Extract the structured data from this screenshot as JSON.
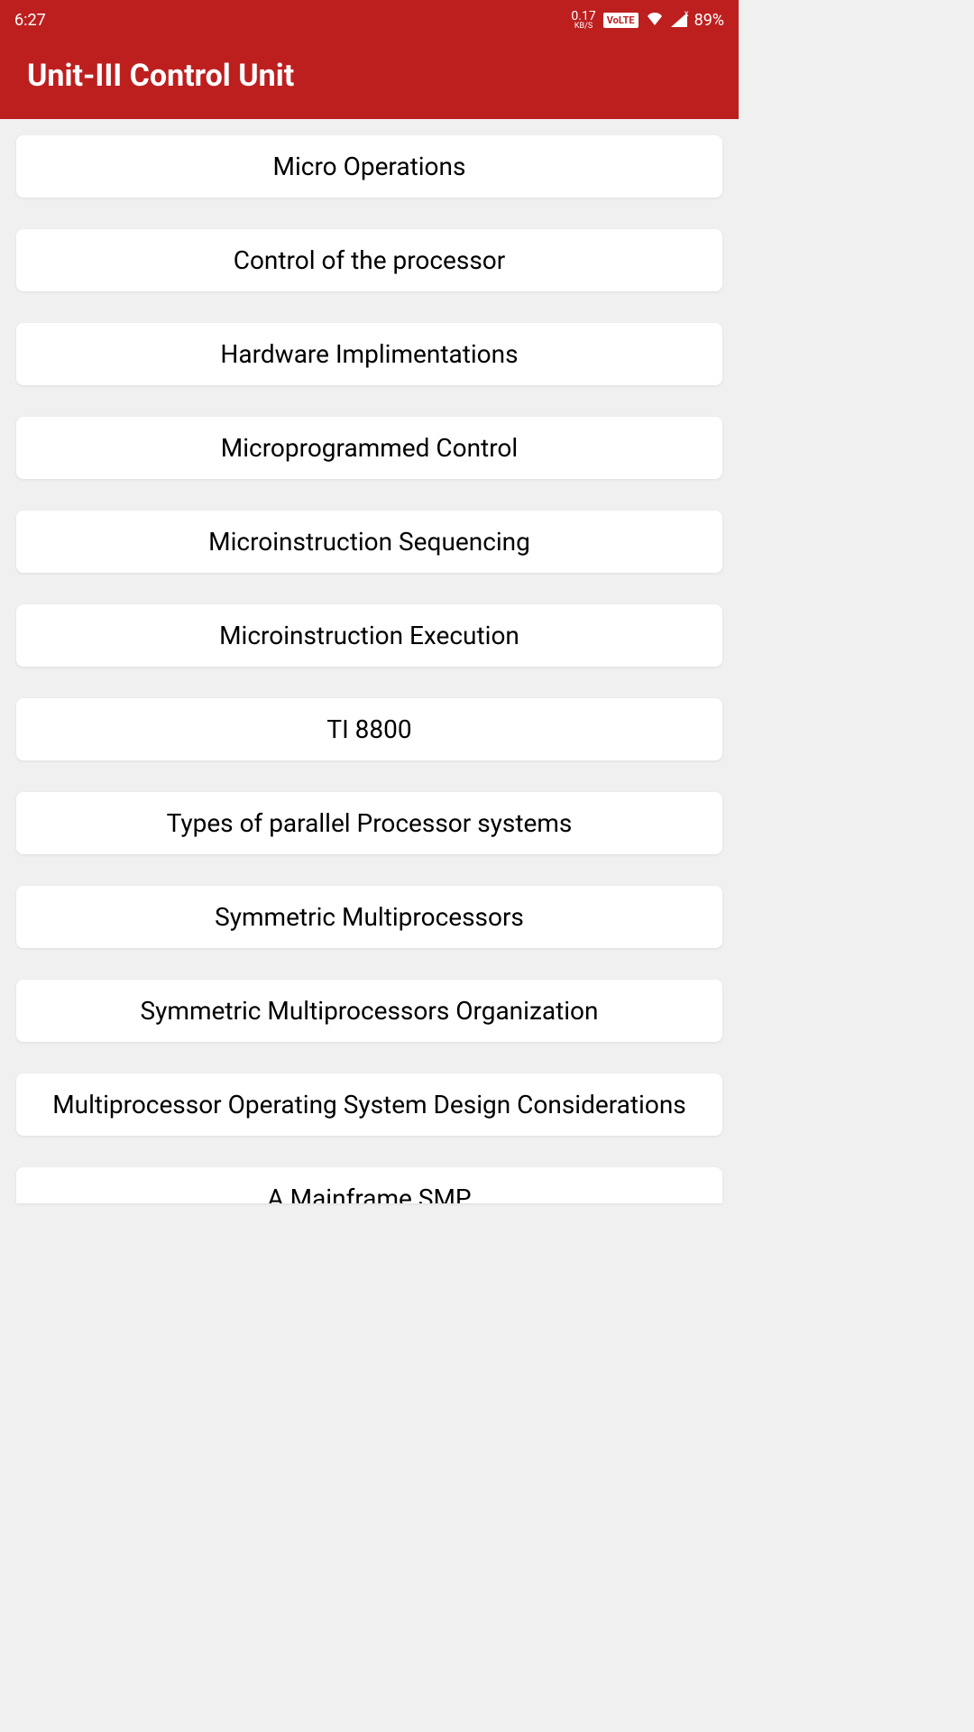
{
  "status_bar": {
    "time": "6:27",
    "data_rate_value": "0.17",
    "data_rate_unit": "KB/S",
    "volte": "VoLTE",
    "signal_indicator": "x",
    "battery": "89%"
  },
  "header": {
    "title": "Unit-III Control Unit"
  },
  "topics": [
    "Micro Operations",
    "Control of the processor",
    "Hardware Implimentations",
    "Microprogrammed Control",
    "Microinstruction Sequencing",
    "Microinstruction Execution",
    "TI 8800",
    "Types of parallel Processor systems",
    "Symmetric Multiprocessors",
    "Symmetric Multiprocessors Organization",
    "Multiprocessor Operating System Design Considerations",
    "A Mainframe SMP"
  ]
}
